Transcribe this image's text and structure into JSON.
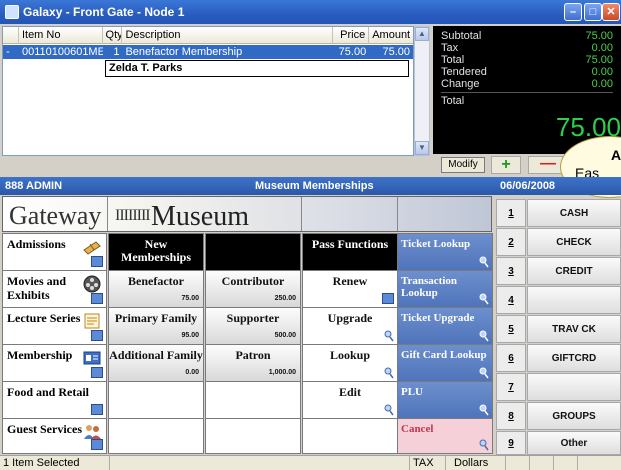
{
  "window": {
    "title": "Galaxy - Front Gate - Node 1"
  },
  "grid": {
    "columns": [
      "Item No",
      "Qty",
      "Description",
      "Price",
      "Amount"
    ],
    "row": {
      "marker": "-",
      "item_no": "00110100601ME",
      "qty": "1",
      "description": "Benefactor Membership",
      "price": "75.00",
      "amount": "75.00"
    },
    "member_name": "Zelda T. Parks"
  },
  "totals": {
    "rows": [
      {
        "label": "Subtotal",
        "value": "75.00"
      },
      {
        "label": "Tax",
        "value": "0.00"
      },
      {
        "label": "Total",
        "value": "75.00"
      },
      {
        "label": "Tendered",
        "value": "0.00"
      },
      {
        "label": "Change",
        "value": "0.00"
      }
    ],
    "total_label": "Total",
    "big_total": "75.00"
  },
  "modify_label": "Modify",
  "plus_label": "+",
  "minus_label": "—",
  "bubble": {
    "line1": "A",
    "line2": "Eas"
  },
  "bluebar": {
    "user": "888 ADMIN",
    "section": "Museum Memberships",
    "date": "06/06/2008"
  },
  "banner": {
    "gateway": "Gateway",
    "bars": "IIIIIIII",
    "museum": "Museum"
  },
  "categories": [
    {
      "label": "Admissions",
      "icon": "ticket-icon"
    },
    {
      "label": "Movies and Exhibits",
      "icon": "film-reel-icon"
    },
    {
      "label": "Lecture Series",
      "icon": "notepad-icon"
    },
    {
      "label": "Membership",
      "icon": "membership-card-icon"
    },
    {
      "label": "Food and Retail",
      "icon": ""
    },
    {
      "label": "Guest Services",
      "icon": "people-icon"
    }
  ],
  "grid_buttons": {
    "r1": {
      "c1": "New Memberships",
      "c2": "",
      "c3": "Pass Functions",
      "c4": "Ticket Lookup"
    },
    "r2": {
      "c1": "Benefactor",
      "p1": "75.00",
      "c2": "Contributor",
      "p2": "250.00",
      "c3": "Renew",
      "c4": "Transaction Lookup"
    },
    "r3": {
      "c1": "Primary Family",
      "p1": "95.00",
      "c2": "Supporter",
      "p2": "500.00",
      "c3": "Upgrade",
      "c4": "Ticket Upgrade"
    },
    "r4": {
      "c1": "Additional Family",
      "p1": "0.00",
      "c2": "Patron",
      "p2": "1,000.00",
      "c3": "Lookup",
      "c4": "Gift Card Lookup"
    },
    "r5": {
      "c3": "Edit",
      "c4": "PLU"
    },
    "r6": {
      "c4": "Cancel"
    }
  },
  "tender": [
    {
      "num": "1",
      "label": "CASH"
    },
    {
      "num": "2",
      "label": "CHECK"
    },
    {
      "num": "3",
      "label": "CREDIT"
    },
    {
      "num": "4",
      "label": ""
    },
    {
      "num": "5",
      "label": "TRAV CK"
    },
    {
      "num": "6",
      "label": "GIFTCRD"
    },
    {
      "num": "7",
      "label": ""
    },
    {
      "num": "8",
      "label": "GROUPS"
    },
    {
      "num": "9",
      "label": "Other"
    }
  ],
  "status": {
    "selection": "1 Item Selected",
    "tax": "TAX",
    "currency": "Dollars"
  },
  "colors": {
    "accent_blue": "#2a58ab",
    "total_green": "#29d14a",
    "cancel_pink": "#f6d0d8"
  }
}
